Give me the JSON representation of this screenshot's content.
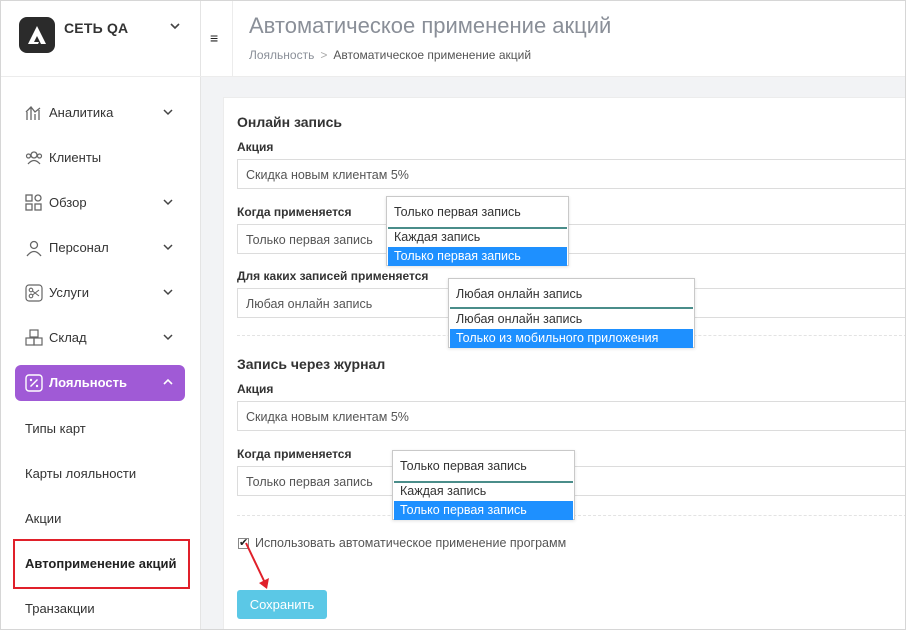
{
  "brand": {
    "name": "СЕТЬ QA"
  },
  "sidebar": {
    "items": [
      {
        "label": "Аналитика",
        "icon": "chart-icon",
        "has_chevron": true
      },
      {
        "label": "Клиенты",
        "icon": "users-icon",
        "has_chevron": false
      },
      {
        "label": "Обзор",
        "icon": "grid-icon",
        "has_chevron": true
      },
      {
        "label": "Персонал",
        "icon": "user-icon",
        "has_chevron": true
      },
      {
        "label": "Услуги",
        "icon": "scissors-icon",
        "has_chevron": true
      },
      {
        "label": "Склад",
        "icon": "boxes-icon",
        "has_chevron": true
      },
      {
        "label": "Лояльность",
        "icon": "percent-icon",
        "has_chevron": true,
        "active": true
      }
    ],
    "sub_items": [
      {
        "label": "Типы карт"
      },
      {
        "label": "Карты лояльности"
      },
      {
        "label": "Акции"
      },
      {
        "label": "Автоприменение акций",
        "active": true
      },
      {
        "label": "Транзакции"
      }
    ]
  },
  "header": {
    "menu_icon": "≡",
    "title": "Автоматическое применение акций",
    "breadcrumb": {
      "parent": "Лояльность",
      "separator": ">",
      "current": "Автоматическое применение акций"
    }
  },
  "online": {
    "title": "Онлайн запись",
    "promo_label": "Акция",
    "promo_value": "Скидка новым клиентам 5%",
    "when_label": "Когда применяется",
    "when_value": "Только первая запись",
    "when_dropdown": {
      "current": "Только первая запись",
      "options": [
        "Каждая запись",
        "Только первая запись"
      ],
      "selected_index": 1
    },
    "which_label": "Для каких записей применяется",
    "which_value": "Любая онлайн запись",
    "which_dropdown": {
      "current": "Любая онлайн запись",
      "options": [
        "Любая онлайн запись",
        "Только из мобильного приложения"
      ],
      "selected_index": 1
    }
  },
  "journal": {
    "title": "Запись через журнал",
    "promo_label": "Акция",
    "promo_value": "Скидка новым клиентам 5%",
    "when_label": "Когда применяется",
    "when_value": "Только первая запись",
    "when_dropdown": {
      "current": "Только первая запись",
      "options": [
        "Каждая запись",
        "Только первая запись"
      ],
      "selected_index": 1
    }
  },
  "auto_apply": {
    "label": "Использовать автоматическое применение программ",
    "checked": true,
    "check_mark": "✔"
  },
  "save_label": "Сохранить",
  "colors": {
    "accent": "#a05ad6",
    "save": "#5bc8e6",
    "highlight_box": "#e0202a",
    "option_selected": "#1e90ff"
  }
}
